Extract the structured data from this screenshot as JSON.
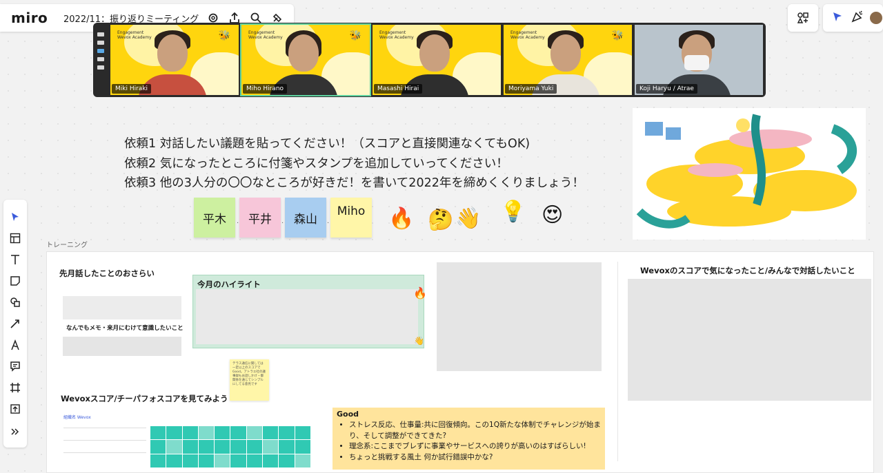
{
  "app": {
    "logo": "miro",
    "board_title": "2022/11：振り返りミーティング"
  },
  "toolbar_icons": [
    "settings-icon",
    "share-icon",
    "search-icon",
    "plugin-icon"
  ],
  "right_tools": [
    "shapes-grid-icon",
    "reactions-icon",
    "celebrate-icon",
    "avatar"
  ],
  "participants": [
    {
      "name": "Miki Hiraki",
      "selected": false
    },
    {
      "name": "Miho Hirano",
      "selected": true
    },
    {
      "name": "Masashi Hirai",
      "selected": false
    },
    {
      "name": "Moriyama Yuki",
      "selected": false
    },
    {
      "name": "Koji Haryu / Atrae",
      "selected": false
    }
  ],
  "instructions": [
    "依頼1 対話したい議題を貼ってください！（スコアと直接関連なくてもOK)",
    "依頼2 気になったところに付箋やスタンプを追加していってください！",
    "依頼3 他の3人分の〇〇なところが好きだ！を書いて2022年を締めくくりましょう！"
  ],
  "stickies": [
    {
      "label": "平木",
      "color": "#cdf0a0"
    },
    {
      "label": "平井",
      "color": "#f7c6d9"
    },
    {
      "label": "森山",
      "color": "#a8cdf0"
    },
    {
      "label": "Miho",
      "color": "#fff6a8"
    }
  ],
  "stamps": [
    "🔥",
    "🤔",
    "👋",
    "💡",
    "😍"
  ],
  "frame": {
    "label": "トレーニング",
    "recap_title": "先月話したことのおさらい",
    "recap_note": "なんでもメモ・来月にむけて意識したいこと",
    "highlight_title": "今月のハイライト",
    "wevox_title": "Wevoxスコア/チーパフォスコアを見てみよう",
    "right_title": "Wevoxのスコアで気になったこと/みんなで対話したいこと",
    "good": {
      "title": "Good",
      "items": [
        "ストレス反応、仕事量:共に回復傾向。この1Q新たな体制でチャレンジが始まり、そして調整ができてきた?",
        "理念系:ここまでブレずに事業やサービスへの誇りが高いのはすばらしい!",
        "ちょっと挑戦する風土 何か試行錯誤中かな?"
      ]
    }
  }
}
